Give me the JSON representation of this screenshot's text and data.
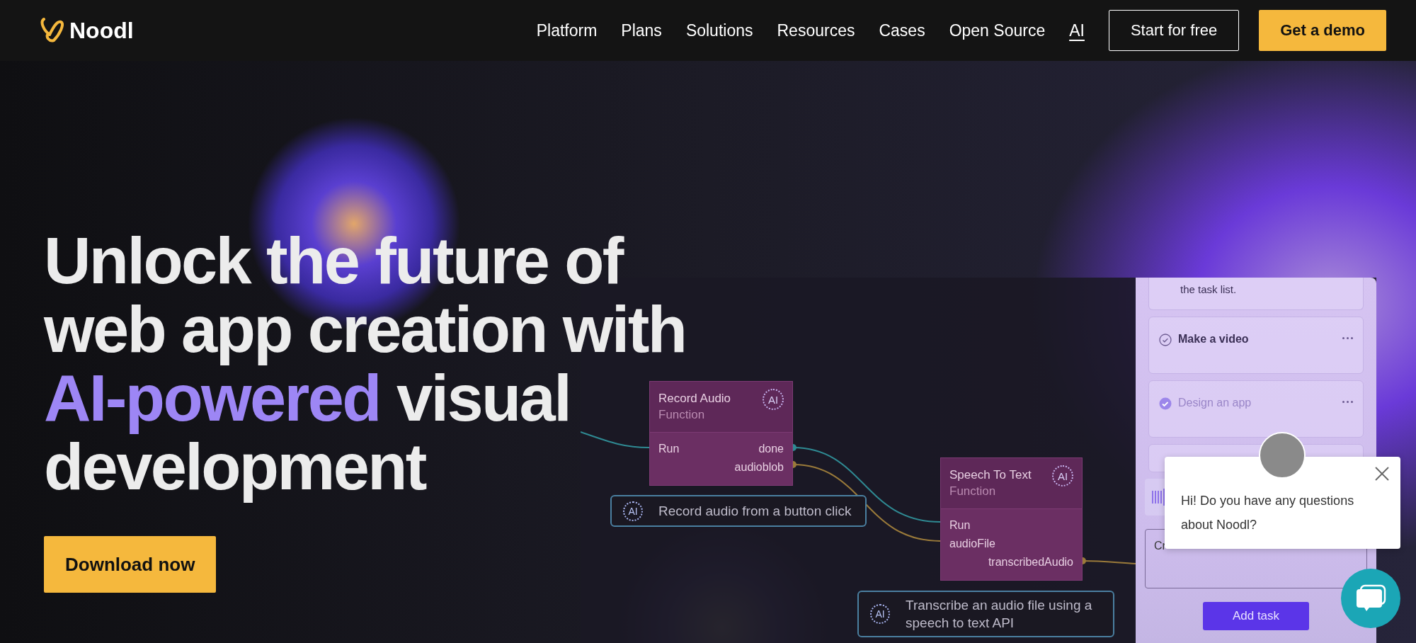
{
  "nav": {
    "logo": "Noodl",
    "links": [
      {
        "label": "Platform",
        "underlined": false
      },
      {
        "label": "Plans",
        "underlined": false
      },
      {
        "label": "Solutions",
        "underlined": false
      },
      {
        "label": "Resources",
        "underlined": false
      },
      {
        "label": "Cases",
        "underlined": false
      },
      {
        "label": "Open Source",
        "underlined": false
      },
      {
        "label": "AI",
        "underlined": true
      }
    ],
    "buttons": [
      {
        "label": "Start for free",
        "kind": "outline"
      },
      {
        "label": "Get a demo",
        "kind": "filled"
      }
    ]
  },
  "hero": {
    "headline": [
      [
        {
          "text": "Unlock the future of",
          "accent": false
        }
      ],
      [
        {
          "text": "web app creation with",
          "accent": false
        }
      ],
      [
        {
          "text": "AI-powered",
          "accent": true
        },
        {
          "text": " visual",
          "accent": false
        }
      ],
      [
        {
          "text": "development",
          "accent": false
        }
      ]
    ],
    "button": "Download now"
  },
  "editor": {
    "nodes": [
      {
        "title": "Record Audio",
        "subtitle": "Function",
        "badge": "AI",
        "rows": [
          {
            "input": "Run",
            "output": "done"
          },
          {
            "output": "audioblob"
          }
        ]
      },
      {
        "title": "Speech To Text",
        "subtitle": "Function",
        "badge": "AI",
        "rows": [
          {
            "input": "Run"
          },
          {
            "input": "audioFile"
          },
          {
            "output": "transcribedAudio"
          }
        ]
      }
    ],
    "comments": [
      {
        "badge": "AI",
        "text": "Record audio from a button click"
      },
      {
        "badge": "AI",
        "text": "Transcribe an audio file using a speech to text API"
      }
    ]
  },
  "task_panel": {
    "partial_note": "the task list.",
    "tasks": [
      {
        "text": "Make a video",
        "checked": false
      },
      {
        "text": "Design an app",
        "checked": true
      }
    ],
    "input_value": "Cr",
    "add_button": "Add task"
  },
  "chat": {
    "message": "Hi! Do you have any questions about Noodl?"
  }
}
